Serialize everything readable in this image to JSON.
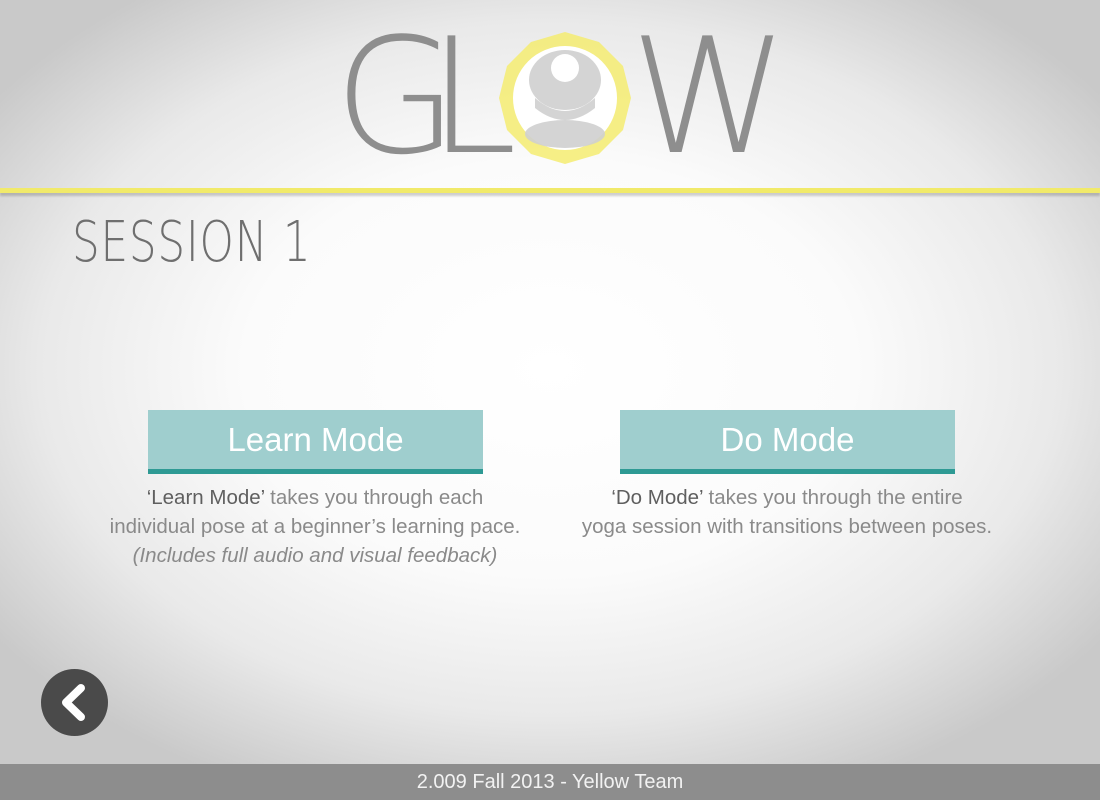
{
  "logo": {
    "letters": [
      "G",
      "L",
      "W"
    ]
  },
  "session": {
    "title": "SESSION 1"
  },
  "learn": {
    "button_label": "Learn Mode",
    "desc_quote": "‘Learn Mode’",
    "desc_rest1": " takes you through each",
    "desc_line2": "individual pose at a beginner’s learning pace.",
    "desc_note": "(Includes full audio and visual feedback)"
  },
  "do": {
    "button_label": "Do Mode",
    "desc_quote": "‘Do Mode’",
    "desc_rest1": " takes you through the entire",
    "desc_line2": "yoga session with transitions between poses."
  },
  "back": {
    "icon": "chevron-left-icon"
  },
  "footer": {
    "text": "2.009 Fall 2013 - Yellow Team"
  },
  "colors": {
    "accent_yellow": "#f1ea6a",
    "button_teal": "#9fcece",
    "button_border": "#2e9a94",
    "footer_bg": "#8d8d8d"
  }
}
